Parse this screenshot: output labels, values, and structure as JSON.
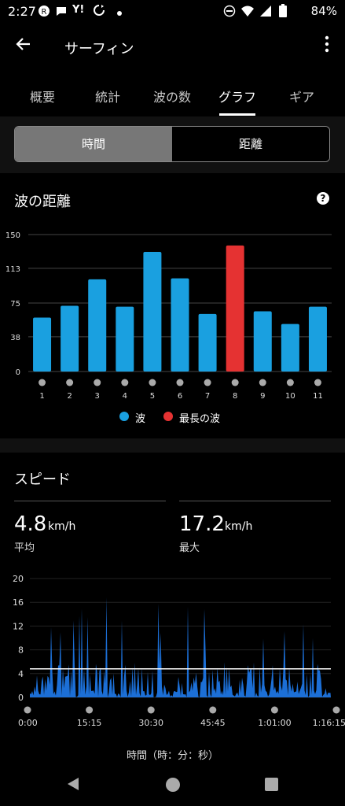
{
  "status": {
    "time": "2:27",
    "battery": "84%",
    "icons": [
      "badge-icon",
      "chat-icon",
      "yahoo-icon",
      "sync-icon",
      "dot-icon"
    ]
  },
  "appbar": {
    "title": "サーフィン"
  },
  "tabs": [
    {
      "label": "概要",
      "active": false
    },
    {
      "label": "統計",
      "active": false
    },
    {
      "label": "波の数",
      "active": false
    },
    {
      "label": "グラフ",
      "active": true
    },
    {
      "label": "ギア",
      "active": false
    }
  ],
  "segment": {
    "options": [
      "時間",
      "距離"
    ],
    "selected": "時間"
  },
  "distance_card": {
    "title": "波の距離",
    "legend": [
      "波",
      "最長の波"
    ]
  },
  "speed_card": {
    "title": "スピード",
    "avg": {
      "value": "4.8",
      "unit": "km/h",
      "label": "平均"
    },
    "max": {
      "value": "17.2",
      "unit": "km/h",
      "label": "最大"
    },
    "xlabel": "時間（時：分：秒）"
  },
  "colors": {
    "wave": "#1AA0E0",
    "longest": "#E53232",
    "speed": "#1C6FD6",
    "avgline": "#ffffff"
  },
  "chart_data": [
    {
      "type": "bar",
      "title": "波の距離",
      "categories": [
        "1",
        "2",
        "3",
        "4",
        "5",
        "6",
        "7",
        "8",
        "9",
        "10",
        "11"
      ],
      "series": [
        {
          "name": "波",
          "values": [
            59,
            72,
            101,
            71,
            131,
            102,
            63,
            138,
            66,
            52,
            71
          ]
        }
      ],
      "highlight_index": 7,
      "highlight_name": "最長の波",
      "yticks": [
        "0",
        "38",
        "75",
        "113",
        "150"
      ],
      "ylim": [
        0,
        150
      ],
      "legend": "bottom-center",
      "grid": true
    },
    {
      "type": "area",
      "title": "スピード",
      "xticks": [
        "0:00",
        "15:15",
        "30:30",
        "45:45",
        "1:01:00",
        "1:16:15"
      ],
      "yticks": [
        "0",
        "4",
        "8",
        "12",
        "16",
        "20"
      ],
      "ylim": [
        0,
        20
      ],
      "xlabel": "時間（時：分：秒）",
      "average": 4.8,
      "max": 17.2
    }
  ]
}
